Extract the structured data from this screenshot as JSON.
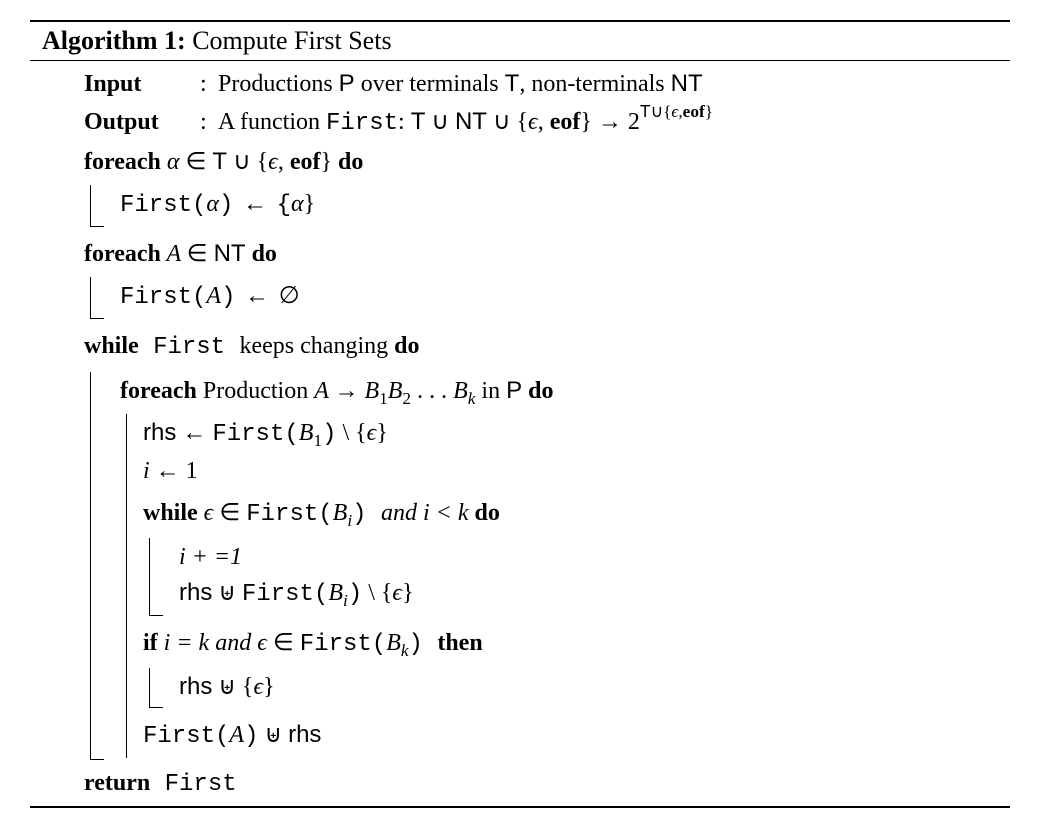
{
  "algorithm": {
    "number": "Algorithm 1:",
    "title": " Compute First Sets"
  },
  "io": {
    "input_label": "Input",
    "output_label": "Output",
    "input_text_1": "Productions ",
    "P": "P",
    "input_text_2": " over terminals ",
    "T": "T",
    "input_text_3": ", non-terminals ",
    "NT": "NT",
    "output_text_1": "A function ",
    "First": "First",
    "colon_sp": ": ",
    "union": " ∪ ",
    "lbrace": " ∪ {",
    "eps": "ϵ",
    "comma_sp": ", ",
    "eof": "eof",
    "rbrace_arrow": "} → 2",
    "exp_T": "T",
    "exp_rest_1": "∪{",
    "exp_eps": "ϵ",
    "exp_comma": ",",
    "exp_eof": "eof",
    "exp_rbrace": "}"
  },
  "kw": {
    "foreach": "foreach",
    "do": "do",
    "while": "while",
    "if": "if",
    "then": "then",
    "and": "and",
    "return": "return"
  },
  "l1": {
    "alpha": " α ",
    "in": "∈ ",
    "T": "T",
    "cup_l": " ∪ {",
    "eps": "ϵ",
    "comma": ", ",
    "eof": "eof",
    "rbrace": "} "
  },
  "l2": {
    "first_open": "First(",
    "alpha": "α",
    "close_assign": ") ← {",
    "alpha2": "α",
    "rbrace": "}"
  },
  "l3": {
    "A": " A ",
    "in": "∈ ",
    "NT": "NT",
    "sp": " "
  },
  "l4": {
    "first_open": "First(",
    "A": "A",
    "close_assign": ") ← ∅"
  },
  "l5": {
    "sp_First": " First ",
    "keeps": "keeps changing "
  },
  "l6": {
    "prod": " Production ",
    "A": "A ",
    "arrow": "→ ",
    "B": "B",
    "s1": "1",
    "B2": "B",
    "s2": "2",
    "dots": " . . . ",
    "Bk": "B",
    "sk": "k",
    "in": " in ",
    "P": "P",
    "sp": " "
  },
  "l7": {
    "rhs": "rhs",
    "assign": " ← ",
    "first_open": "First(",
    "B": "B",
    "s1": "1",
    "close": ")",
    "setminus": " \\ {",
    "eps": "ϵ",
    "rbrace": "}"
  },
  "l8": {
    "i": "i ",
    "assign": "← 1"
  },
  "l9": {
    "eps": " ϵ ",
    "in": "∈ ",
    "first_open": "First(",
    "B": "B",
    "si": "i",
    "close": ") ",
    "i_lt_k": " i < k "
  },
  "l10": {
    "i_plus": "i + =1"
  },
  "l11": {
    "rhs": "rhs",
    "uplus": " ⊎ ",
    "first_open": "First(",
    "B": "B",
    "si": "i",
    "close": ")",
    "setminus": " \\ {",
    "eps": "ϵ",
    "rbrace": "}"
  },
  "l12": {
    "i_eq_k": " i = k ",
    "eps": " ϵ ",
    "in": "∈ ",
    "first_open": "First(",
    "B": "B",
    "sk": "k",
    "close": ") "
  },
  "l13": {
    "rhs": "rhs",
    "uplus": " ⊎ {",
    "eps": "ϵ",
    "rbrace": "}"
  },
  "l14": {
    "first_open": "First(",
    "A": "A",
    "close": ")",
    "uplus": " ⊎ ",
    "rhs": "rhs"
  },
  "ret": {
    "First": " First"
  }
}
